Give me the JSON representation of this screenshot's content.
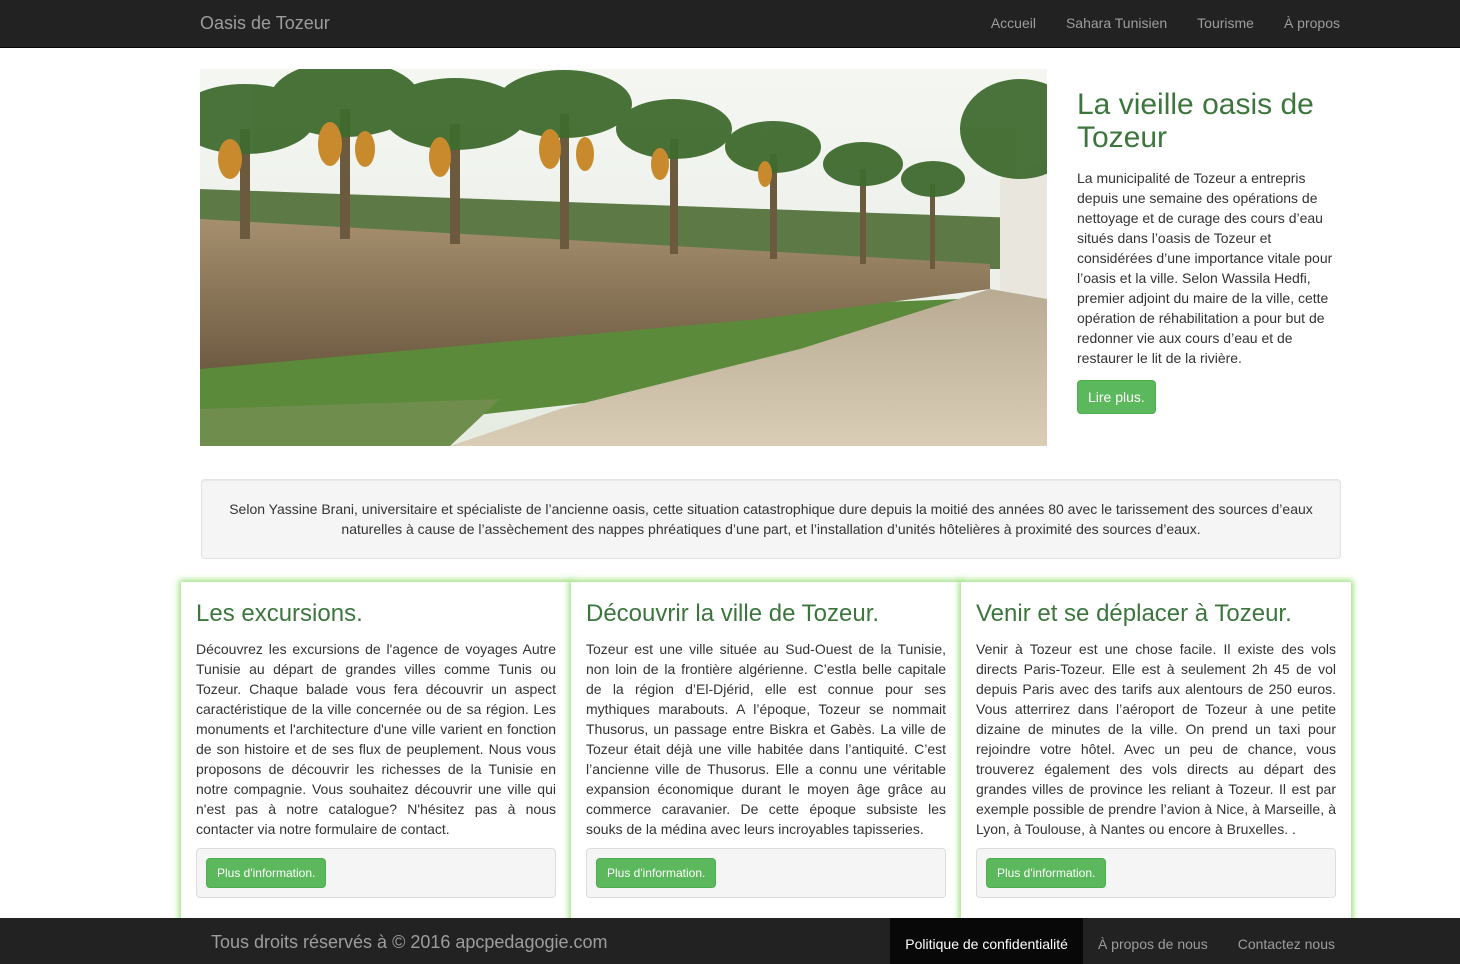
{
  "navbar": {
    "brand": "Oasis de Tozeur",
    "items": [
      "Accueil",
      "Sahara Tunisien",
      "Tourisme",
      "À propos"
    ]
  },
  "hero": {
    "image_icon": "palm-oasis-photo",
    "title": "La vieille oasis de Tozeur",
    "body": "La municipalité de Tozeur a entrepris depuis une semaine des opérations de nettoyage et de curage des cours d’eau situés dans l’oasis de Tozeur et considérées d’une importance vitale pour l’oasis et la ville. Selon Wassila Hedfi, premier adjoint du maire de la ville, cette opération de réhabilitation a pour but de redonner vie aux cours d’eau et de restaurer le lit de la rivière.",
    "button": "Lire plus."
  },
  "well": {
    "text": "Selon Yassine Brani, universitaire et spécialiste de l’ancienne oasis, cette situation catastrophique dure depuis la moitié des années 80 avec le tarissement des sources d’eaux naturelles à cause de l’assèchement des nappes phréatiques d’une part, et l’installation d’unités hôtelières à proximité des sources d’eaux."
  },
  "cards": [
    {
      "title": "Les excursions.",
      "body": "Découvrez les excursions de l'agence de voyages Autre Tunisie au départ de grandes villes comme Tunis ou Tozeur. Chaque balade vous fera découvrir un aspect caractéristique de la ville concernée ou de sa région. Les monuments et l'architecture d'une ville varient en fonction de son histoire et de ses flux de peuplement. Nous vous proposons de découvrir les richesses de la Tunisie en notre compagnie. Vous souhaitez découvrir une ville qui n'est pas à notre catalogue? N'hésitez pas à nous contacter via notre formulaire de contact.",
      "button": "Plus d'information."
    },
    {
      "title": "Découvrir la ville de Tozeur.",
      "body": "Tozeur est une ville située au Sud-Ouest de la Tunisie, non loin de la frontière algérienne. C’estla belle capitale de la région d’El-Djérid, elle est connue pour ses mythiques marabouts. A l’époque, Tozeur se nommait Thusorus, un passage entre Biskra et Gabès. La ville de Tozeur était déjà une ville habitée dans l’antiquité. C’est l’ancienne ville de Thusorus. Elle a connu une véritable expansion économique durant le moyen âge grâce au commerce caravanier. De cette époque subsiste les souks de la médina avec leurs incroyables tapisseries.",
      "button": "Plus d'information."
    },
    {
      "title": "Venir et se déplacer à Tozeur.",
      "body": "Venir à Tozeur est une chose facile. Il existe des vols directs Paris-Tozeur. Elle est à seulement 2h 45 de vol depuis Paris avec des tarifs aux alentours de 250 euros. Vous atterrirez dans l’aéroport de Tozeur à une petite dizaine de minutes de la ville. On prend un taxi pour rejoindre votre hôtel. Avec un peu de chance, vous trouverez également des vols directs au départ des grandes villes de province les reliant à Tozeur. Il est par exemple possible de prendre l’avion à Nice, à Marseille, à Lyon, à Toulouse, à Nantes ou encore à Bruxelles. .",
      "button": "Plus d'information."
    }
  ],
  "footer": {
    "copyright": "Tous droits réservés à © 2016 apcpedagogie.com",
    "links": [
      "Politique de confidentialité",
      "À propos de nous",
      "Contactez nous"
    ]
  },
  "colors": {
    "navbar_bg": "#222222",
    "heading_green": "#3c763d",
    "button_green": "#5cb85c",
    "card_glow": "#9be07a"
  }
}
